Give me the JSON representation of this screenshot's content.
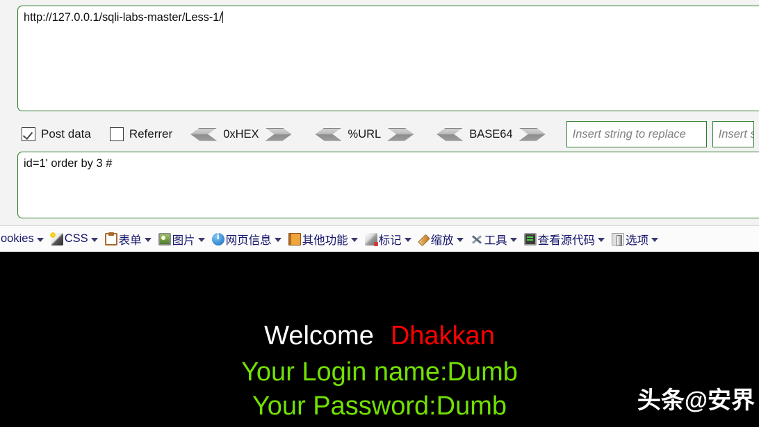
{
  "hackbar": {
    "url_value": "http://127.0.0.1/sqli-labs-master/Less-1/",
    "post_value": "id=1' order by 3 #",
    "checkboxes": [
      {
        "label": "Post data",
        "checked": true
      },
      {
        "label": "Referrer",
        "checked": false
      }
    ],
    "encoders": [
      {
        "label": "0xHEX"
      },
      {
        "label": "%URL"
      },
      {
        "label": "BASE64"
      }
    ],
    "replace_inputs": [
      {
        "placeholder": "Insert string to replace",
        "value": ""
      },
      {
        "placeholder": "Insert string to replace with",
        "value": ""
      }
    ]
  },
  "menubar": {
    "items": [
      {
        "label": "ookies",
        "icon": "cookies-icon",
        "has_icon": false,
        "caret": true
      },
      {
        "label": "CSS",
        "icon": "wand",
        "has_icon": true,
        "caret": true
      },
      {
        "label": "表单",
        "icon": "clipboard",
        "has_icon": true,
        "caret": true
      },
      {
        "label": "图片",
        "icon": "photo",
        "has_icon": true,
        "caret": true
      },
      {
        "label": "网页信息",
        "icon": "info",
        "has_icon": true,
        "caret": true
      },
      {
        "label": "其他功能",
        "icon": "book",
        "has_icon": true,
        "caret": true
      },
      {
        "label": "标记",
        "icon": "pencil",
        "has_icon": true,
        "caret": true
      },
      {
        "label": "缩放",
        "icon": "ruler",
        "has_icon": true,
        "caret": true
      },
      {
        "label": "工具",
        "icon": "tools",
        "has_icon": true,
        "caret": true
      },
      {
        "label": "查看源代码",
        "icon": "screen",
        "has_icon": true,
        "caret": true
      },
      {
        "label": "选项",
        "icon": "switch",
        "has_icon": true,
        "caret": true
      }
    ]
  },
  "page": {
    "welcome_text": "Welcome",
    "welcome_name": "Dhakkan",
    "login_line": "Your Login name:Dumb",
    "password_line": "Your Password:Dumb",
    "watermark": "头条@安界"
  },
  "colors": {
    "border_green": "#2a7a2a",
    "text_green": "#72e003",
    "text_red": "#ff0000",
    "page_bg": "#000000",
    "panel_bg": "#f3f3f3",
    "menu_text": "#15156b"
  }
}
